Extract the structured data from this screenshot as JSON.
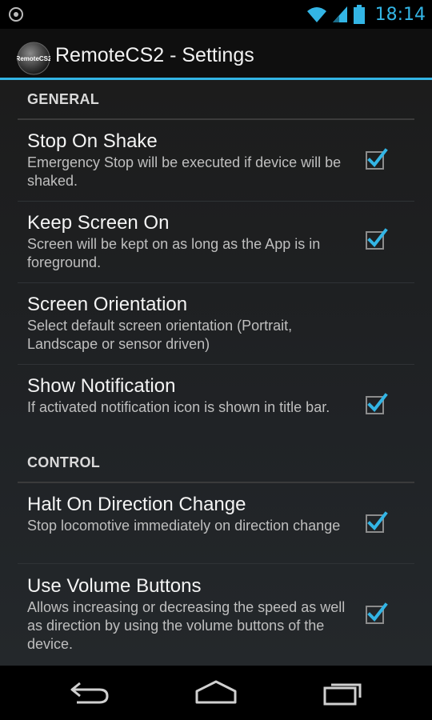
{
  "status_bar": {
    "time": "18:14",
    "colors": {
      "accent": "#33b5e5"
    },
    "icons": [
      "notification-icon",
      "wifi-icon",
      "signal-icon",
      "battery-icon"
    ]
  },
  "action_bar": {
    "title": "RemoteCS2 - Settings",
    "app_icon_text": "RemoteCS2"
  },
  "categories": [
    {
      "label": "GENERAL"
    },
    {
      "label": "CONTROL"
    }
  ],
  "preferences": [
    {
      "title": "Stop On Shake",
      "summary": "Emergency Stop will be executed if device will be shaked.",
      "checked": true
    },
    {
      "title": "Keep Screen On",
      "summary": "Screen will be kept on as long as the App is in foreground.",
      "checked": true
    },
    {
      "title": "Screen Orientation",
      "summary": "Select default screen orientation (Portrait, Landscape or sensor driven)",
      "checked": null
    },
    {
      "title": "Show Notification",
      "summary": "If activated notification icon is shown in title bar.",
      "checked": true
    },
    {
      "title": "Halt On Direction Change",
      "summary": "Stop locomotive immediately on direction change",
      "checked": true
    },
    {
      "title": "Use Volume Buttons",
      "summary": "Allows increasing or decreasing the speed as well as direction by using the volume buttons of the device.",
      "checked": true
    }
  ],
  "nav_bar": {
    "buttons": [
      "back-icon",
      "home-icon",
      "recent-apps-icon"
    ]
  }
}
